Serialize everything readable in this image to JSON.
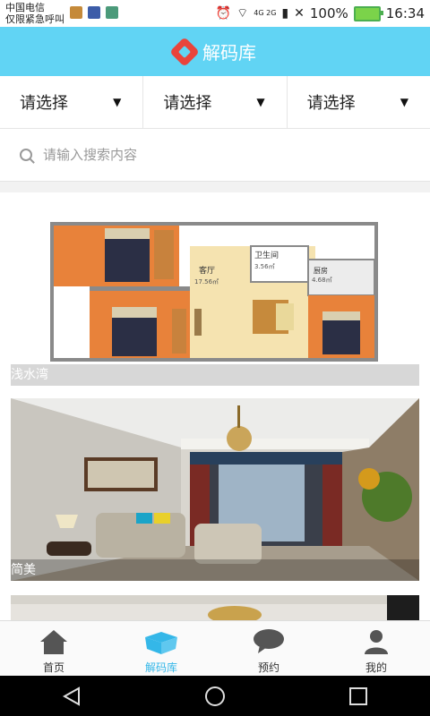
{
  "status_bar": {
    "carrier": "中国电信",
    "emergency": "仅限紧急呼叫",
    "network": "4G 2G",
    "battery_percent": "100%",
    "time": "16:34"
  },
  "header": {
    "title": "解码库"
  },
  "filters": [
    {
      "label": "请选择"
    },
    {
      "label": "请选择"
    },
    {
      "label": "请选择"
    }
  ],
  "search": {
    "placeholder": "请输入搜索内容"
  },
  "floorplan": {
    "rooms": {
      "living": "客厅",
      "living_area": "17.56㎡",
      "bath": "卫生间",
      "bath_area": "3.56㎡",
      "kitchen": "厨房",
      "kitchen_area": "4.68㎡"
    }
  },
  "cards": [
    {
      "caption": "浅水湾"
    },
    {
      "caption": "简美"
    },
    {
      "caption": ""
    }
  ],
  "bottom_nav": [
    {
      "label": "首页",
      "icon": "home-icon"
    },
    {
      "label": "解码库",
      "icon": "box-icon",
      "active": true
    },
    {
      "label": "预约",
      "icon": "chat-bubble-icon"
    },
    {
      "label": "我的",
      "icon": "user-icon"
    }
  ],
  "colors": {
    "accent": "#61d4f4",
    "active_nav": "#34b7e8",
    "logo": "#e9443b"
  }
}
